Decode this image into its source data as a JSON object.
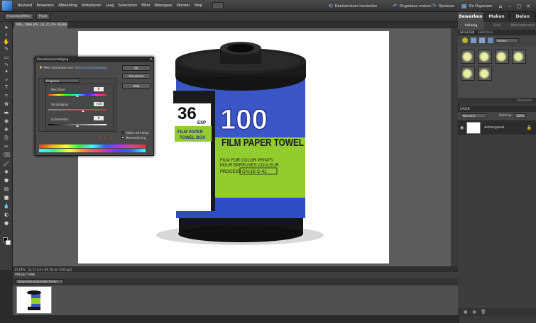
{
  "menubar": {
    "items": [
      "Bestand",
      "Bewerken",
      "Afbeelding",
      "Verbeteren",
      "Laag",
      "Selecteren",
      "Filter",
      "Weergave",
      "Venster",
      "Help"
    ],
    "undo": "Deelvensters herstellen",
    "redo": "Ongedaan maken",
    "redo2": "Opnieuw",
    "organizer": "De Organizer"
  },
  "options": {
    "tool": "Houtskoolfilter",
    "size": "Plaat"
  },
  "doc_tab": "IMG_1986.JPG (3)_25,2% (RGB/8)*",
  "status": {
    "zoom": "25,18%",
    "docsize": "52,71 cm x 86,78 cm (180 ppi)"
  },
  "project_bin": {
    "title": "PROJECTVAK",
    "filter": "Geopende bestanden tonen"
  },
  "modes": [
    "Bewerken",
    "Maken",
    "Delen"
  ],
  "subtabs": [
    "Volledig",
    "Snel",
    "Met instructies"
  ],
  "effects": {
    "title": "EFFECTEN",
    "tab2": "GRAFISCH",
    "dropdown": "Anders",
    "footer": "Toepassen"
  },
  "layers": {
    "title": "LAGEN",
    "blend": "Normaal",
    "opacity_label": "Dekking:",
    "opacity": "100%",
    "layer_name": "Achtergrond"
  },
  "dialog": {
    "title": "Kleurtoon/verzadiging",
    "info": "Meer informatie over:",
    "info_link": "Kleurtoon/verzadiging",
    "ok": "OK",
    "reset": "Annuleren",
    "help": "Help",
    "channel": "Origineel",
    "hue_label": "Kleurtoon:",
    "hue_value": "0",
    "sat_label": "Verzadiging:",
    "sat_value": "+20",
    "light_label": "Lichtsterkte:",
    "light_value": "0",
    "colorize": "Vullen met kleur",
    "preview": "Voorvertoning",
    "hue_pct": 0.5,
    "sat_pct": 0.6,
    "light_pct": 0.5
  },
  "image": {
    "exposures": "36",
    "exp_suffix": "EXP",
    "iso": "100",
    "brand": "FILM PAPER TOWEL",
    "box_line1": "FILM PAPER",
    "box_line2": "TOWEL BOX",
    "text1": "FILM FOR COLOR PRINTS",
    "text2": "POUR EPREUVES COULEUR",
    "text3": "PROCESS",
    "code": "CN-16 C-41"
  },
  "colors": {
    "accent": "#7ab8ff",
    "bg": "#2b2b2b"
  }
}
